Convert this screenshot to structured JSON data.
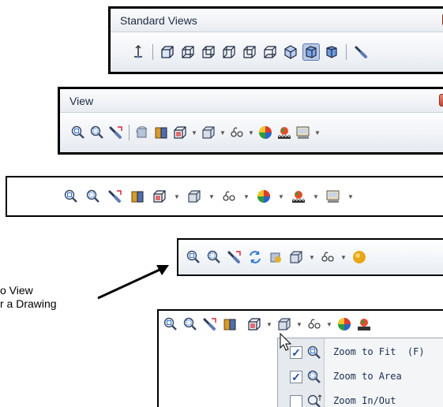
{
  "standard_views_toolbar": {
    "title": "Standard Views",
    "buttons": [
      "normal-to",
      "front",
      "back",
      "left",
      "right",
      "top",
      "bottom",
      "isometric",
      "trimetric",
      "dimetric",
      "view-selector"
    ]
  },
  "view_toolbar": {
    "title": "View",
    "buttons": [
      "zoom-to-fit",
      "zoom-to-area",
      "previous-view",
      "rotate-view",
      "section-view",
      "view-orientation",
      "display-style",
      "hide-show-items",
      "edit-appearance",
      "apply-scene",
      "view-settings"
    ]
  },
  "heads_up_toolbar_1": {
    "buttons": [
      "zoom-to-fit",
      "zoom-to-area",
      "previous-view",
      "section-view",
      "view-orientation",
      "display-style",
      "hide-show-items",
      "edit-appearance",
      "apply-scene",
      "view-settings"
    ]
  },
  "heads_up_toolbar_2": {
    "buttons": [
      "zoom-to-fit",
      "zoom-to-area",
      "previous-view",
      "rotate-view",
      "view-orientation",
      "display-style",
      "hide-show-items",
      "edit-appearance"
    ]
  },
  "annotation": {
    "line1": "o View",
    "line2": "r a Drawing"
  },
  "dropdown_menu": {
    "items": [
      {
        "label": "Zoom to Fit  (F)",
        "checked": true
      },
      {
        "label": "Zoom to Area",
        "checked": true
      },
      {
        "label": "Zoom In/Out",
        "checked": false
      }
    ]
  }
}
